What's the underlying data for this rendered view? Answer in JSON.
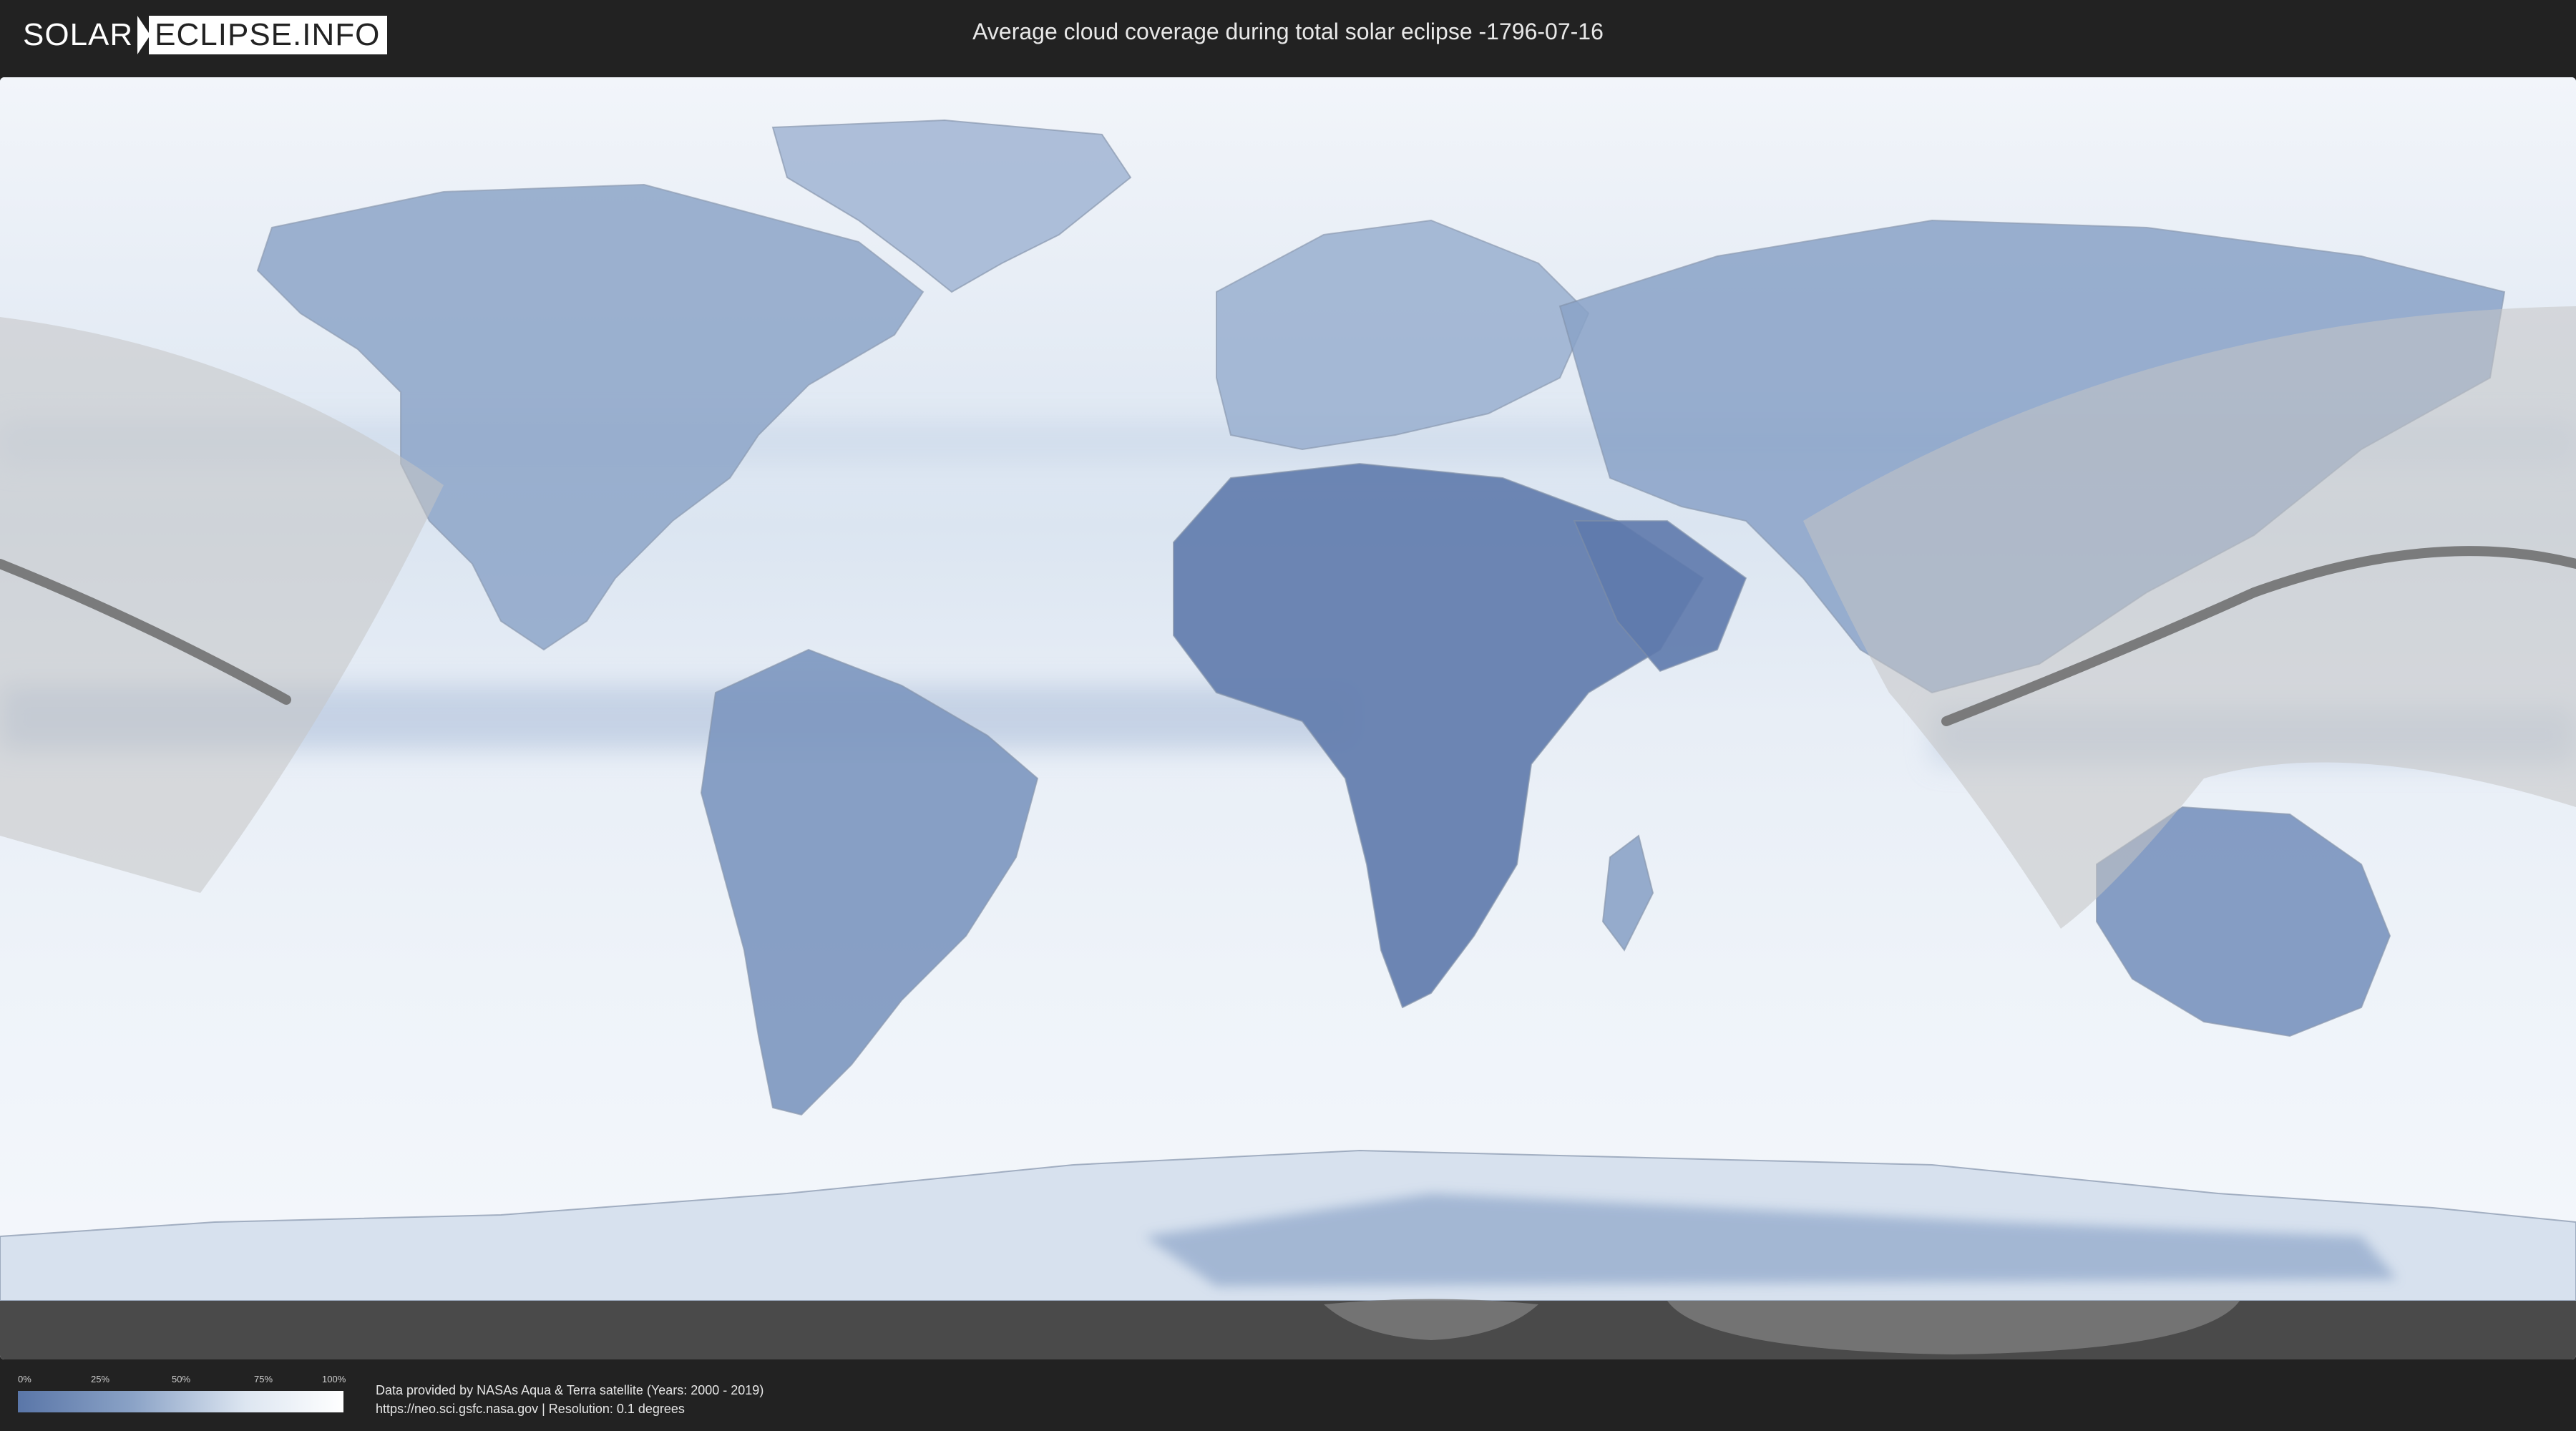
{
  "header": {
    "logo_left": "SOLAR",
    "logo_right": "ECLIPSE.INFO",
    "title": "Average cloud coverage during total solar eclipse -1796-07-16"
  },
  "legend": {
    "ticks": [
      "0%",
      "25%",
      "50%",
      "75%",
      "100%"
    ],
    "colors": {
      "low": "#5a76a8",
      "mid": "#8aa2c6",
      "high": "#ffffff"
    }
  },
  "footer": {
    "credit_line": "Data provided by NASAs Aqua & Terra satellite (Years: 2000 - 2019)",
    "source_line": "https://neo.sci.gsfc.nasa.gov | Resolution: 0.1 degrees"
  },
  "map": {
    "colors": {
      "ocean_cloud": "#e4ecf5",
      "clear_land": "#6a86b6",
      "medium_cloud": "#9fb4d2",
      "eclipse_zone": "#c8c8c8",
      "eclipse_path": "#666666",
      "south_shadow": "#4a4a4a"
    }
  }
}
